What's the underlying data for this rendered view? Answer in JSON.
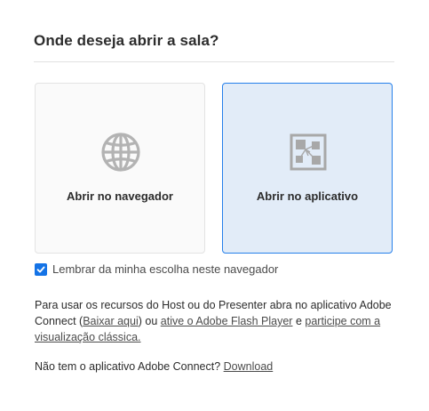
{
  "dialog": {
    "title": "Onde deseja abrir a sala?",
    "options": [
      {
        "label": "Abrir no navegador",
        "icon": "globe-icon",
        "selected": false
      },
      {
        "label": "Abrir no aplicativo",
        "icon": "app-window-icon",
        "selected": true
      }
    ],
    "remember": {
      "label": "Lembrar da minha escolha neste navegador",
      "checked": true
    },
    "info": {
      "text1": "Para usar os recursos do Host ou do Presenter abra no aplicativo Adobe Connect (",
      "link_download_here": "Baixar aqui",
      "text2": ") ou ",
      "link_flash": "ative o Adobe Flash Player",
      "text3": " e ",
      "link_classic": "participe com a visualização clássica."
    },
    "no_app": {
      "text": "Não tem o aplicativo Adobe Connect? ",
      "link_download": "Download"
    }
  },
  "colors": {
    "accent": "#2680eb",
    "selected_bg": "#e2ecf8",
    "checkbox": "#1473e6",
    "icon_gray": "#b3b3b3"
  }
}
